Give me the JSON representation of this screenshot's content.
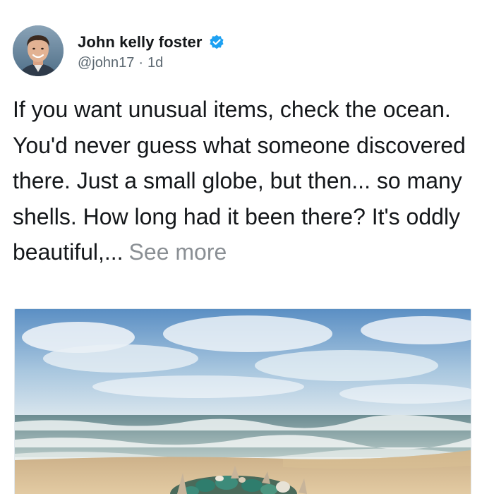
{
  "tweet": {
    "author": {
      "display_name": "John kelly foster",
      "handle": "@john17",
      "separator": "·",
      "time": "1d",
      "verified": true
    },
    "text": "If you want unusual items, check the ocean. You'd never guess what someone discovered there. Just a small globe, but then... so many shells. How long had it been there? It's oddly beautiful,...",
    "see_more_label": "See more",
    "icons": {
      "verified": "verified-badge-icon",
      "avatar": "avatar-photo"
    },
    "colors": {
      "verified": "#1da1f2",
      "text": "#14171a",
      "secondary": "#5b6770",
      "see_more": "#8a8f94"
    }
  }
}
